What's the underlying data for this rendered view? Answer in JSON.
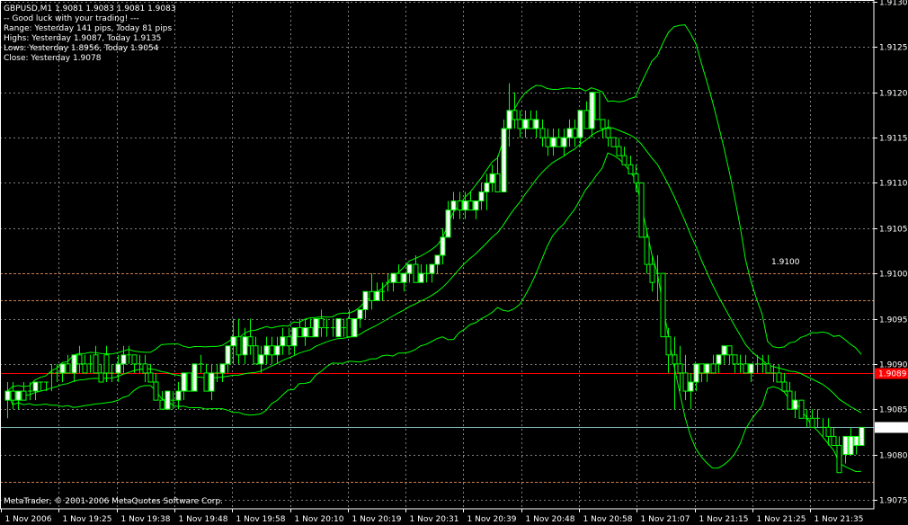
{
  "header": {
    "symbol_line": "GBPUSD,M1  1.9081 1.9083 1.9081 1.9083",
    "comment_lines": [
      "-- Good luck with your trading! ---",
      "Range: Yesterday 141 pips, Today 81 pips",
      "Highs: Yesterday 1.9087, Today 1.9135",
      "Lows:  Yesterday 1.8956, Today 1.9054",
      "Close: Yesterday 1.9078"
    ]
  },
  "footer": {
    "copyright": "MetaTrader, © 2001-2006 MetaQuotes Software Corp."
  },
  "level_label": "1.9100",
  "colors": {
    "background": "#000000",
    "grid": "#808080",
    "bull_candle": "#ffffff",
    "bear_candle": "#000000",
    "candle_outline": "#00ff00",
    "bands": "#00ff00",
    "red_line": "#ff0000",
    "bid_line": "#7fb7b7",
    "orange_dashed": "#c88050",
    "yaxis_red_tag": "#ff0000",
    "yaxis_bid_tag": "#ffffff"
  },
  "chart_data": {
    "type": "candlestick",
    "symbol": "GBPUSD",
    "timeframe": "M1",
    "ylim": [
      1.9074,
      1.913
    ],
    "y_ticks": [
      "1.9130",
      "1.9125",
      "1.9120",
      "1.9115",
      "1.9110",
      "1.9105",
      "1.9100",
      "1.9095",
      "1.9090",
      "1.9085",
      "1.9080",
      "1.9075"
    ],
    "x_ticks": [
      "1 Nov 2006",
      "1 Nov 19:25",
      "1 Nov 19:38",
      "1 Nov 19:48",
      "1 Nov 19:58",
      "1 Nov 20:10",
      "1 Nov 20:19",
      "1 Nov 20:31",
      "1 Nov 20:39",
      "1 Nov 20:48",
      "1 Nov 20:58",
      "1 Nov 21:07",
      "1 Nov 21:15",
      "1 Nov 21:25",
      "1 Nov 21:35"
    ],
    "horizontal_lines": {
      "red_level": "1.9089",
      "bid_level": "1.9083",
      "dashed_levels": [
        1.91,
        1.9097,
        1.9077
      ]
    },
    "candles": [
      {
        "o": 1.9086,
        "h": 1.9088,
        "l": 1.9084,
        "c": 1.9087
      },
      {
        "o": 1.9087,
        "h": 1.9088,
        "l": 1.9085,
        "c": 1.9086
      },
      {
        "o": 1.9086,
        "h": 1.9087,
        "l": 1.9085,
        "c": 1.9087
      },
      {
        "o": 1.9087,
        "h": 1.9088,
        "l": 1.9086,
        "c": 1.9086
      },
      {
        "o": 1.9087,
        "h": 1.9088,
        "l": 1.9086,
        "c": 1.9087
      },
      {
        "o": 1.9087,
        "h": 1.9088,
        "l": 1.9086,
        "c": 1.9088
      },
      {
        "o": 1.9088,
        "h": 1.9088,
        "l": 1.9087,
        "c": 1.9088
      },
      {
        "o": 1.9088,
        "h": 1.9088,
        "l": 1.9087,
        "c": 1.9088
      },
      {
        "o": 1.9089,
        "h": 1.909,
        "l": 1.9087,
        "c": 1.9089
      },
      {
        "o": 1.9089,
        "h": 1.909,
        "l": 1.9088,
        "c": 1.9089
      },
      {
        "o": 1.9089,
        "h": 1.909,
        "l": 1.9088,
        "c": 1.909
      },
      {
        "o": 1.909,
        "h": 1.9091,
        "l": 1.9089,
        "c": 1.9089
      },
      {
        "o": 1.9089,
        "h": 1.9091,
        "l": 1.9088,
        "c": 1.9091
      },
      {
        "o": 1.9091,
        "h": 1.9092,
        "l": 1.9089,
        "c": 1.909
      },
      {
        "o": 1.909,
        "h": 1.9091,
        "l": 1.9089,
        "c": 1.9089
      },
      {
        "o": 1.909,
        "h": 1.9091,
        "l": 1.9089,
        "c": 1.909
      },
      {
        "o": 1.9091,
        "h": 1.9092,
        "l": 1.9089,
        "c": 1.9089
      },
      {
        "o": 1.9089,
        "h": 1.909,
        "l": 1.9088,
        "c": 1.9088
      },
      {
        "o": 1.9091,
        "h": 1.9092,
        "l": 1.9088,
        "c": 1.9089
      },
      {
        "o": 1.9089,
        "h": 1.909,
        "l": 1.9088,
        "c": 1.9089
      },
      {
        "o": 1.9089,
        "h": 1.9091,
        "l": 1.9088,
        "c": 1.909
      },
      {
        "o": 1.909,
        "h": 1.9092,
        "l": 1.9089,
        "c": 1.9091
      },
      {
        "o": 1.9091,
        "h": 1.9092,
        "l": 1.909,
        "c": 1.9091
      },
      {
        "o": 1.9091,
        "h": 1.9091,
        "l": 1.9089,
        "c": 1.909
      },
      {
        "o": 1.909,
        "h": 1.9091,
        "l": 1.9089,
        "c": 1.909
      },
      {
        "o": 1.909,
        "h": 1.9091,
        "l": 1.9088,
        "c": 1.9089
      },
      {
        "o": 1.9089,
        "h": 1.909,
        "l": 1.9088,
        "c": 1.9088
      },
      {
        "o": 1.9088,
        "h": 1.9089,
        "l": 1.9086,
        "c": 1.9086
      },
      {
        "o": 1.9086,
        "h": 1.9087,
        "l": 1.9085,
        "c": 1.9085
      },
      {
        "o": 1.9085,
        "h": 1.9087,
        "l": 1.9085,
        "c": 1.9087
      },
      {
        "o": 1.9086,
        "h": 1.9087,
        "l": 1.9085,
        "c": 1.9086
      },
      {
        "o": 1.9086,
        "h": 1.9088,
        "l": 1.9085,
        "c": 1.9087
      },
      {
        "o": 1.9087,
        "h": 1.9089,
        "l": 1.9086,
        "c": 1.9089
      },
      {
        "o": 1.9089,
        "h": 1.9089,
        "l": 1.9087,
        "c": 1.9087
      },
      {
        "o": 1.9087,
        "h": 1.909,
        "l": 1.9087,
        "c": 1.909
      },
      {
        "o": 1.909,
        "h": 1.9091,
        "l": 1.9089,
        "c": 1.909
      },
      {
        "o": 1.9089,
        "h": 1.909,
        "l": 1.9087,
        "c": 1.9087
      },
      {
        "o": 1.9087,
        "h": 1.909,
        "l": 1.9086,
        "c": 1.9089
      },
      {
        "o": 1.9089,
        "h": 1.909,
        "l": 1.9088,
        "c": 1.9089
      },
      {
        "o": 1.9089,
        "h": 1.909,
        "l": 1.9088,
        "c": 1.909
      },
      {
        "o": 1.909,
        "h": 1.9092,
        "l": 1.9089,
        "c": 1.9092
      },
      {
        "o": 1.9092,
        "h": 1.9095,
        "l": 1.909,
        "c": 1.9093
      },
      {
        "o": 1.9093,
        "h": 1.9095,
        "l": 1.909,
        "c": 1.9091
      },
      {
        "o": 1.9091,
        "h": 1.9094,
        "l": 1.909,
        "c": 1.9093
      },
      {
        "o": 1.9093,
        "h": 1.9095,
        "l": 1.9091,
        "c": 1.9092
      },
      {
        "o": 1.9092,
        "h": 1.9093,
        "l": 1.909,
        "c": 1.909
      },
      {
        "o": 1.909,
        "h": 1.9092,
        "l": 1.9089,
        "c": 1.9091
      },
      {
        "o": 1.9091,
        "h": 1.9093,
        "l": 1.909,
        "c": 1.9092
      },
      {
        "o": 1.9092,
        "h": 1.9093,
        "l": 1.909,
        "c": 1.9091
      },
      {
        "o": 1.9091,
        "h": 1.9093,
        "l": 1.909,
        "c": 1.9092
      },
      {
        "o": 1.9092,
        "h": 1.9094,
        "l": 1.9091,
        "c": 1.9093
      },
      {
        "o": 1.9093,
        "h": 1.9094,
        "l": 1.9091,
        "c": 1.9092
      },
      {
        "o": 1.9092,
        "h": 1.9094,
        "l": 1.9091,
        "c": 1.9094
      },
      {
        "o": 1.9094,
        "h": 1.9095,
        "l": 1.9093,
        "c": 1.9093
      },
      {
        "o": 1.9093,
        "h": 1.9095,
        "l": 1.9092,
        "c": 1.9094
      },
      {
        "o": 1.9094,
        "h": 1.9095,
        "l": 1.9093,
        "c": 1.9093
      },
      {
        "o": 1.9093,
        "h": 1.9095,
        "l": 1.9093,
        "c": 1.9095
      },
      {
        "o": 1.9095,
        "h": 1.9096,
        "l": 1.9093,
        "c": 1.9094
      },
      {
        "o": 1.9094,
        "h": 1.9095,
        "l": 1.9093,
        "c": 1.9094
      },
      {
        "o": 1.9094,
        "h": 1.9095,
        "l": 1.9093,
        "c": 1.9094
      },
      {
        "o": 1.9093,
        "h": 1.9095,
        "l": 1.9093,
        "c": 1.9095
      },
      {
        "o": 1.9094,
        "h": 1.9095,
        "l": 1.9093,
        "c": 1.9094
      },
      {
        "o": 1.9095,
        "h": 1.9096,
        "l": 1.9093,
        "c": 1.9093
      },
      {
        "o": 1.9093,
        "h": 1.9095,
        "l": 1.9093,
        "c": 1.9095
      },
      {
        "o": 1.9095,
        "h": 1.9096,
        "l": 1.9094,
        "c": 1.9096
      },
      {
        "o": 1.9096,
        "h": 1.9098,
        "l": 1.9095,
        "c": 1.9098
      },
      {
        "o": 1.9098,
        "h": 1.91,
        "l": 1.9096,
        "c": 1.9097
      },
      {
        "o": 1.9097,
        "h": 1.9099,
        "l": 1.9097,
        "c": 1.9098
      },
      {
        "o": 1.9098,
        "h": 1.9099,
        "l": 1.9097,
        "c": 1.9098
      },
      {
        "o": 1.9099,
        "h": 1.91,
        "l": 1.9098,
        "c": 1.9099
      },
      {
        "o": 1.9099,
        "h": 1.91,
        "l": 1.9098,
        "c": 1.91
      },
      {
        "o": 1.91,
        "h": 1.9101,
        "l": 1.9099,
        "c": 1.9099
      },
      {
        "o": 1.9099,
        "h": 1.91,
        "l": 1.9098,
        "c": 1.91
      },
      {
        "o": 1.91,
        "h": 1.9101,
        "l": 1.9099,
        "c": 1.9101
      },
      {
        "o": 1.9101,
        "h": 1.9102,
        "l": 1.9099,
        "c": 1.9099
      },
      {
        "o": 1.9099,
        "h": 1.9101,
        "l": 1.9099,
        "c": 1.91
      },
      {
        "o": 1.91,
        "h": 1.9101,
        "l": 1.9099,
        "c": 1.91
      },
      {
        "o": 1.91,
        "h": 1.9101,
        "l": 1.9099,
        "c": 1.9101
      },
      {
        "o": 1.9101,
        "h": 1.9102,
        "l": 1.91,
        "c": 1.9102
      },
      {
        "o": 1.9102,
        "h": 1.9105,
        "l": 1.9101,
        "c": 1.9104
      },
      {
        "o": 1.9104,
        "h": 1.9108,
        "l": 1.9104,
        "c": 1.9107
      },
      {
        "o": 1.9107,
        "h": 1.9109,
        "l": 1.9106,
        "c": 1.9108
      },
      {
        "o": 1.9108,
        "h": 1.9109,
        "l": 1.9106,
        "c": 1.9107
      },
      {
        "o": 1.9107,
        "h": 1.9109,
        "l": 1.9106,
        "c": 1.9108
      },
      {
        "o": 1.9108,
        "h": 1.9109,
        "l": 1.9107,
        "c": 1.9107
      },
      {
        "o": 1.9107,
        "h": 1.9108,
        "l": 1.9106,
        "c": 1.9108
      },
      {
        "o": 1.9108,
        "h": 1.911,
        "l": 1.9107,
        "c": 1.9109
      },
      {
        "o": 1.9109,
        "h": 1.9111,
        "l": 1.9107,
        "c": 1.911
      },
      {
        "o": 1.911,
        "h": 1.9112,
        "l": 1.9109,
        "c": 1.9111
      },
      {
        "o": 1.9111,
        "h": 1.9113,
        "l": 1.9109,
        "c": 1.9109
      },
      {
        "o": 1.9109,
        "h": 1.9117,
        "l": 1.9109,
        "c": 1.9116
      },
      {
        "o": 1.9116,
        "h": 1.9121,
        "l": 1.9114,
        "c": 1.9118
      },
      {
        "o": 1.9118,
        "h": 1.912,
        "l": 1.9116,
        "c": 1.9117
      },
      {
        "o": 1.9117,
        "h": 1.9118,
        "l": 1.9115,
        "c": 1.9116
      },
      {
        "o": 1.9116,
        "h": 1.9118,
        "l": 1.9115,
        "c": 1.9117
      },
      {
        "o": 1.9117,
        "h": 1.9118,
        "l": 1.9116,
        "c": 1.9116
      },
      {
        "o": 1.9116,
        "h": 1.9118,
        "l": 1.9115,
        "c": 1.9117
      },
      {
        "o": 1.9116,
        "h": 1.9117,
        "l": 1.9114,
        "c": 1.9115
      },
      {
        "o": 1.9115,
        "h": 1.9116,
        "l": 1.9113,
        "c": 1.9114
      },
      {
        "o": 1.9114,
        "h": 1.9116,
        "l": 1.9113,
        "c": 1.9115
      },
      {
        "o": 1.9115,
        "h": 1.9116,
        "l": 1.9114,
        "c": 1.9114
      },
      {
        "o": 1.9114,
        "h": 1.9116,
        "l": 1.9113,
        "c": 1.9115
      },
      {
        "o": 1.9115,
        "h": 1.9117,
        "l": 1.9114,
        "c": 1.9116
      },
      {
        "o": 1.9116,
        "h": 1.9117,
        "l": 1.9114,
        "c": 1.9115
      },
      {
        "o": 1.9115,
        "h": 1.9118,
        "l": 1.9114,
        "c": 1.9118
      },
      {
        "o": 1.9118,
        "h": 1.9119,
        "l": 1.9116,
        "c": 1.9116
      },
      {
        "o": 1.9116,
        "h": 1.912,
        "l": 1.9115,
        "c": 1.912
      },
      {
        "o": 1.912,
        "h": 1.912,
        "l": 1.9117,
        "c": 1.9117
      },
      {
        "o": 1.9117,
        "h": 1.9117,
        "l": 1.9115,
        "c": 1.9116
      },
      {
        "o": 1.9116,
        "h": 1.9117,
        "l": 1.9114,
        "c": 1.9115
      },
      {
        "o": 1.9115,
        "h": 1.9115,
        "l": 1.9114,
        "c": 1.9114
      },
      {
        "o": 1.9114,
        "h": 1.9115,
        "l": 1.9113,
        "c": 1.9113
      },
      {
        "o": 1.9113,
        "h": 1.9114,
        "l": 1.9112,
        "c": 1.9112
      },
      {
        "o": 1.9112,
        "h": 1.9113,
        "l": 1.9111,
        "c": 1.9111
      },
      {
        "o": 1.9111,
        "h": 1.9112,
        "l": 1.9109,
        "c": 1.911
      },
      {
        "o": 1.911,
        "h": 1.911,
        "l": 1.9104,
        "c": 1.9104
      },
      {
        "o": 1.9104,
        "h": 1.9105,
        "l": 1.91,
        "c": 1.9101
      },
      {
        "o": 1.9101,
        "h": 1.9102,
        "l": 1.9098,
        "c": 1.9099
      },
      {
        "o": 1.91,
        "h": 1.9102,
        "l": 1.9097,
        "c": 1.91
      },
      {
        "o": 1.91,
        "h": 1.91,
        "l": 1.9093,
        "c": 1.9093
      },
      {
        "o": 1.9093,
        "h": 1.9094,
        "l": 1.9089,
        "c": 1.9091
      },
      {
        "o": 1.9091,
        "h": 1.9093,
        "l": 1.9085,
        "c": 1.909
      },
      {
        "o": 1.909,
        "h": 1.9092,
        "l": 1.9087,
        "c": 1.9089
      },
      {
        "o": 1.9089,
        "h": 1.9091,
        "l": 1.9086,
        "c": 1.9087
      },
      {
        "o": 1.9087,
        "h": 1.9089,
        "l": 1.9085,
        "c": 1.9088
      },
      {
        "o": 1.9088,
        "h": 1.909,
        "l": 1.9087,
        "c": 1.909
      },
      {
        "o": 1.909,
        "h": 1.909,
        "l": 1.9088,
        "c": 1.9089
      },
      {
        "o": 1.9089,
        "h": 1.909,
        "l": 1.9088,
        "c": 1.909
      },
      {
        "o": 1.909,
        "h": 1.9091,
        "l": 1.9089,
        "c": 1.9089
      },
      {
        "o": 1.909,
        "h": 1.9091,
        "l": 1.9089,
        "c": 1.9091
      },
      {
        "o": 1.9091,
        "h": 1.9092,
        "l": 1.909,
        "c": 1.9092
      },
      {
        "o": 1.9092,
        "h": 1.9092,
        "l": 1.909,
        "c": 1.9091
      },
      {
        "o": 1.9091,
        "h": 1.9091,
        "l": 1.9089,
        "c": 1.909
      },
      {
        "o": 1.909,
        "h": 1.9091,
        "l": 1.9089,
        "c": 1.909
      },
      {
        "o": 1.909,
        "h": 1.9091,
        "l": 1.9089,
        "c": 1.9089
      },
      {
        "o": 1.9089,
        "h": 1.909,
        "l": 1.9088,
        "c": 1.909
      },
      {
        "o": 1.909,
        "h": 1.9091,
        "l": 1.9089,
        "c": 1.909
      },
      {
        "o": 1.909,
        "h": 1.9091,
        "l": 1.9089,
        "c": 1.909
      },
      {
        "o": 1.909,
        "h": 1.9091,
        "l": 1.9089,
        "c": 1.9089
      },
      {
        "o": 1.9089,
        "h": 1.909,
        "l": 1.9088,
        "c": 1.9089
      },
      {
        "o": 1.9089,
        "h": 1.909,
        "l": 1.9088,
        "c": 1.9088
      },
      {
        "o": 1.9088,
        "h": 1.9089,
        "l": 1.9087,
        "c": 1.9087
      },
      {
        "o": 1.9087,
        "h": 1.9088,
        "l": 1.9085,
        "c": 1.9085
      },
      {
        "o": 1.9085,
        "h": 1.9087,
        "l": 1.9084,
        "c": 1.9086
      },
      {
        "o": 1.9086,
        "h": 1.9086,
        "l": 1.9084,
        "c": 1.9084
      },
      {
        "o": 1.9084,
        "h": 1.9085,
        "l": 1.9083,
        "c": 1.9084
      },
      {
        "o": 1.9084,
        "h": 1.9085,
        "l": 1.9083,
        "c": 1.9083
      },
      {
        "o": 1.9084,
        "h": 1.9085,
        "l": 1.9083,
        "c": 1.9084
      },
      {
        "o": 1.9083,
        "h": 1.9084,
        "l": 1.9082,
        "c": 1.9083
      },
      {
        "o": 1.9083,
        "h": 1.9084,
        "l": 1.9081,
        "c": 1.9082
      },
      {
        "o": 1.9082,
        "h": 1.9083,
        "l": 1.9081,
        "c": 1.9081
      },
      {
        "o": 1.9081,
        "h": 1.9082,
        "l": 1.9078,
        "c": 1.9078
      },
      {
        "o": 1.908,
        "h": 1.9082,
        "l": 1.9079,
        "c": 1.9082
      },
      {
        "o": 1.908,
        "h": 1.9083,
        "l": 1.908,
        "c": 1.9082
      },
      {
        "o": 1.9081,
        "h": 1.9082,
        "l": 1.908,
        "c": 1.9082
      },
      {
        "o": 1.9081,
        "h": 1.9083,
        "l": 1.9081,
        "c": 1.9083
      }
    ]
  }
}
